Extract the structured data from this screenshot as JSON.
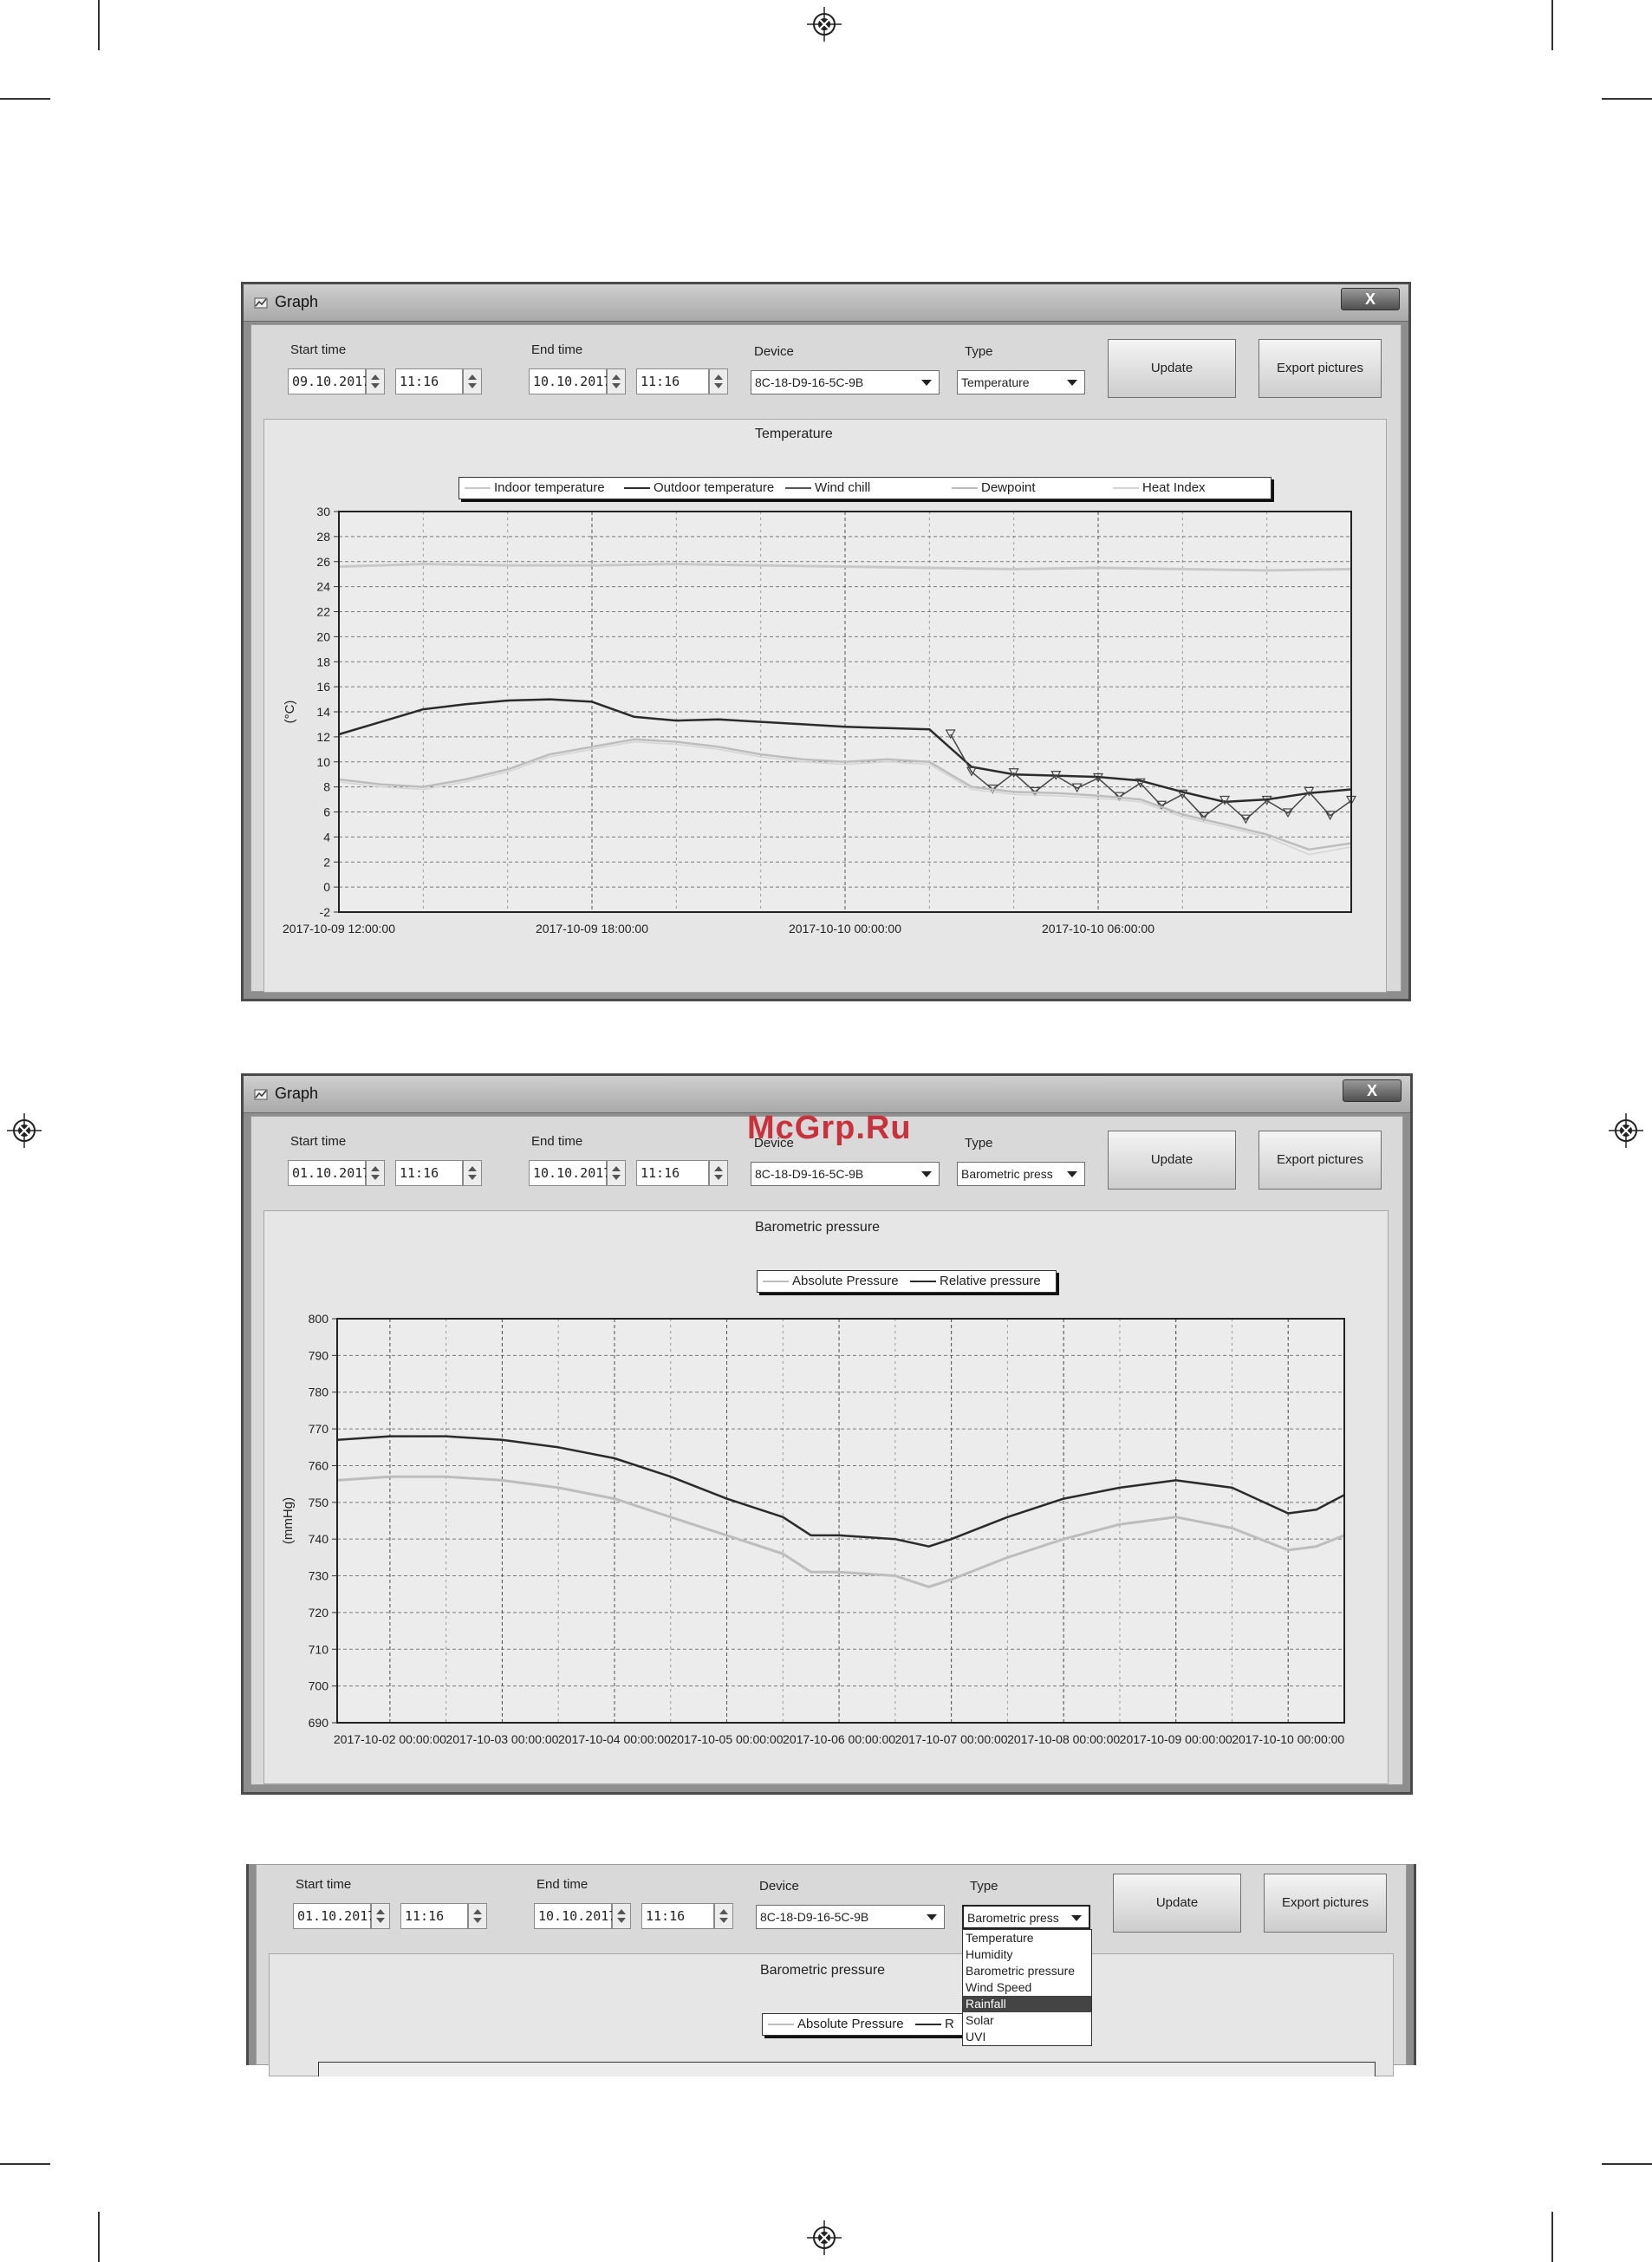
{
  "watermark": "McGrp.Ru",
  "window1": {
    "title": "Graph",
    "close_label": "X",
    "start_time_label": "Start time",
    "start_date": "09.10.2017",
    "start_time": "11:16",
    "end_time_label": "End time",
    "end_date": "10.10.2017",
    "end_time": "11:16",
    "device_label": "Device",
    "device_value": "8C-18-D9-16-5C-9B",
    "type_label": "Type",
    "type_value": "Temperature",
    "update_label": "Update",
    "export_label": "Export pictures"
  },
  "window2": {
    "title": "Graph",
    "close_label": "X",
    "start_time_label": "Start time",
    "start_date": "01.10.2017",
    "start_time": "11:16",
    "end_time_label": "End time",
    "end_date": "10.10.2017",
    "end_time": "11:16",
    "device_label": "Device",
    "device_value": "8C-18-D9-16-5C-9B",
    "type_label": "Type",
    "type_value": "Barometric press",
    "update_label": "Update",
    "export_label": "Export pictures"
  },
  "window3": {
    "start_time_label": "Start time",
    "start_date": "01.10.2017",
    "start_time": "11:16",
    "end_time_label": "End time",
    "end_date": "10.10.2017",
    "end_time": "11:16",
    "device_label": "Device",
    "device_value": "8C-18-D9-16-5C-9B",
    "type_label": "Type",
    "type_value": "Barometric press",
    "update_label": "Update",
    "export_label": "Export pictures",
    "chart_title": "Barometric pressure",
    "legend_visible": "Absolute Pressure",
    "legend_cut": "R",
    "dropdown_options": [
      "Temperature",
      "Humidity",
      "Barometric pressure",
      "Wind Speed",
      "Rainfall",
      "Solar",
      "UVI"
    ],
    "dropdown_highlighted": "Rainfall"
  },
  "colors": {
    "dark_series": "#2b2b2b",
    "light_series": "#bdbdbd",
    "indoor_series": "#c8c8c8"
  },
  "chart_data": [
    {
      "type": "line",
      "title": "Temperature",
      "xlabel": "",
      "ylabel": "(°C)",
      "ylim": [
        -2,
        30
      ],
      "yticks": [
        -2,
        0,
        2,
        4,
        6,
        8,
        10,
        12,
        14,
        16,
        18,
        20,
        22,
        24,
        26,
        28,
        30
      ],
      "x_range_hours": [
        0,
        24
      ],
      "x_tick_hours": [
        0,
        6,
        12,
        18
      ],
      "x_tick_labels": [
        "2017-10-09 12:00:00",
        "2017-10-09 18:00:00",
        "2017-10-10 00:00:00",
        "2017-10-10 06:00:00"
      ],
      "grid": true,
      "legend": "top",
      "series": [
        {
          "name": "Indoor temperature",
          "x": [
            0,
            2,
            4,
            6,
            8,
            10,
            12,
            14,
            16,
            18,
            20,
            22,
            24
          ],
          "values": [
            25.6,
            25.8,
            25.7,
            25.7,
            25.8,
            25.7,
            25.6,
            25.5,
            25.4,
            25.5,
            25.4,
            25.3,
            25.4
          ]
        },
        {
          "name": "Outdoor temperature",
          "x": [
            0,
            1,
            2,
            3,
            4,
            5,
            6,
            7,
            8,
            9,
            10,
            11,
            12,
            13,
            14,
            15,
            16,
            17,
            18,
            19,
            20,
            21,
            22,
            23,
            24
          ],
          "values": [
            12.2,
            13.2,
            14.2,
            14.6,
            14.9,
            15.0,
            14.8,
            13.6,
            13.3,
            13.4,
            13.2,
            13.0,
            12.8,
            12.7,
            12.6,
            9.6,
            9.0,
            8.9,
            8.8,
            8.5,
            7.6,
            6.8,
            7.0,
            7.5,
            7.8
          ]
        },
        {
          "name": "Wind chill",
          "x": [
            14.5,
            15,
            15.5,
            16,
            16.5,
            17,
            17.5,
            18,
            18.5,
            19,
            19.5,
            20,
            20.5,
            21,
            21.5,
            22,
            22.5,
            23,
            23.5,
            24
          ],
          "values": [
            12.2,
            9.2,
            7.8,
            9.1,
            7.6,
            8.9,
            7.9,
            8.7,
            7.2,
            8.3,
            6.5,
            7.4,
            5.6,
            6.9,
            5.4,
            6.9,
            5.9,
            7.6,
            5.7,
            6.9
          ]
        },
        {
          "name": "Dewpoint",
          "x": [
            0,
            1,
            2,
            3,
            4,
            5,
            6,
            7,
            8,
            9,
            10,
            11,
            12,
            13,
            14,
            15,
            16,
            17,
            18,
            19,
            20,
            21,
            22,
            23,
            24
          ],
          "values": [
            8.6,
            8.2,
            8.0,
            8.6,
            9.4,
            10.6,
            11.2,
            11.8,
            11.6,
            11.2,
            10.6,
            10.2,
            10.0,
            10.2,
            10.0,
            8.0,
            7.6,
            7.5,
            7.3,
            7.0,
            5.8,
            5.0,
            4.2,
            3.0,
            3.5
          ]
        },
        {
          "name": "Heat Index",
          "x": [
            0,
            1,
            2,
            3,
            4,
            5,
            6,
            7,
            8,
            9,
            10,
            11,
            12,
            13,
            14,
            15,
            16,
            17,
            18,
            19,
            20,
            21,
            22,
            23,
            24
          ],
          "values": [
            8.4,
            8.0,
            7.8,
            8.4,
            9.2,
            10.4,
            11.0,
            11.6,
            11.4,
            11.0,
            10.4,
            10.0,
            9.8,
            10.0,
            9.8,
            7.8,
            7.4,
            7.3,
            7.1,
            6.8,
            5.6,
            4.8,
            4.0,
            2.6,
            3.2
          ]
        }
      ]
    },
    {
      "type": "line",
      "title": "Barometric pressure",
      "xlabel": "",
      "ylabel": "(mmHg)",
      "ylim": [
        690,
        800
      ],
      "yticks": [
        690,
        700,
        710,
        720,
        730,
        740,
        750,
        760,
        770,
        780,
        790,
        800
      ],
      "x_range_days": [
        0.53,
        9.5
      ],
      "x_tick_days": [
        1,
        2,
        3,
        4,
        5,
        6,
        7,
        8,
        9
      ],
      "x_tick_labels": [
        "2017-10-02 00:00:00",
        "2017-10-03 00:00:00",
        "2017-10-04 00:00:00",
        "2017-10-05 00:00:00",
        "2017-10-06 00:00:00",
        "2017-10-07 00:00:00",
        "2017-10-08 00:00:00",
        "2017-10-09 00:00:00",
        "2017-10-10 00:00:00"
      ],
      "grid": true,
      "legend": "top",
      "series": [
        {
          "name": "Absolute Pressure",
          "x": [
            0.53,
            1.0,
            1.5,
            2.0,
            2.5,
            3.0,
            3.5,
            4.0,
            4.5,
            4.75,
            5.0,
            5.5,
            5.8,
            6.0,
            6.5,
            7.0,
            7.5,
            8.0,
            8.5,
            9.0,
            9.25,
            9.5
          ],
          "values": [
            756,
            757,
            757,
            756,
            754,
            751,
            746,
            741,
            736,
            731,
            731,
            730,
            727,
            729,
            735,
            740,
            744,
            746,
            743,
            737,
            738,
            741
          ]
        },
        {
          "name": "Relative pressure",
          "x": [
            0.53,
            1.0,
            1.5,
            2.0,
            2.5,
            3.0,
            3.5,
            4.0,
            4.5,
            4.75,
            5.0,
            5.5,
            5.8,
            6.0,
            6.5,
            7.0,
            7.5,
            8.0,
            8.5,
            9.0,
            9.25,
            9.5
          ],
          "values": [
            767,
            768,
            768,
            767,
            765,
            762,
            757,
            751,
            746,
            741,
            741,
            740,
            738,
            740,
            746,
            751,
            754,
            756,
            754,
            747,
            748,
            752
          ]
        }
      ]
    }
  ]
}
